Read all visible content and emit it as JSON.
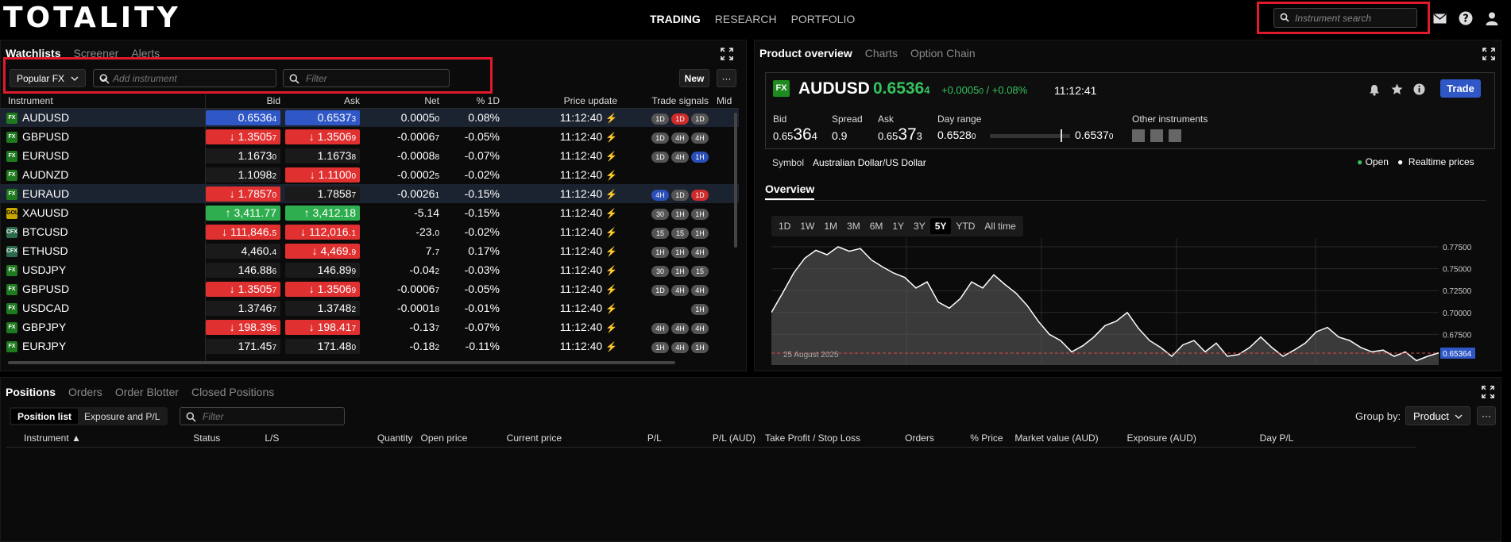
{
  "brand": {
    "logo": "TOTALITY"
  },
  "nav": {
    "items": [
      "TRADING",
      "RESEARCH",
      "PORTFOLIO"
    ]
  },
  "search": {
    "placeholder": "Instrument search"
  },
  "colors": {
    "positive": "#35c25e",
    "negative": "#e04848",
    "accent": "#2f57c6",
    "highlight": "#e01a2b"
  },
  "watchlist": {
    "tabs": [
      "Watchlists",
      "Screener",
      "Alerts"
    ],
    "selected_list": "Popular FX",
    "add_placeholder": "Add instrument",
    "filter_placeholder": "Filter",
    "new_label": "New",
    "more_label": "···",
    "columns": [
      "Instrument",
      "Bid",
      "Ask",
      "Net",
      "% 1D",
      "Price update",
      "Trade signals",
      "Mid"
    ],
    "rows": [
      {
        "icon": "FX",
        "name": "AUDUSD",
        "bid": "0.6536",
        "bid_s": "4",
        "bid_c": "blue",
        "ask": "0.6537",
        "ask_s": "3",
        "ask_c": "blue",
        "net": "0.0005",
        "net_s": "0",
        "pct": "0.08%",
        "dir": "pos",
        "time": "11:12:40",
        "signals": [
          "1D",
          "1D",
          "1D"
        ],
        "sig_colors": [
          "",
          "r",
          ""
        ]
      },
      {
        "icon": "FX",
        "name": "GBPUSD",
        "bid": "↓ 1.3505",
        "bid_s": "7",
        "bid_c": "red",
        "ask": "↓ 1.3506",
        "ask_s": "9",
        "ask_c": "red",
        "net": "-0.0006",
        "net_s": "7",
        "pct": "-0.05%",
        "dir": "neg",
        "time": "11:12:40",
        "signals": [
          "1D",
          "4H",
          "4H"
        ],
        "sig_colors": [
          "",
          "",
          ""
        ]
      },
      {
        "icon": "FX",
        "name": "EURUSD",
        "bid": "1.1673",
        "bid_s": "0",
        "bid_c": "plain",
        "ask": "1.1673",
        "ask_s": "8",
        "ask_c": "plain",
        "net": "-0.0008",
        "net_s": "8",
        "pct": "-0.07%",
        "dir": "neg",
        "time": "11:12:40",
        "signals": [
          "1D",
          "4H",
          "1H"
        ],
        "sig_colors": [
          "",
          "",
          "b"
        ]
      },
      {
        "icon": "FX",
        "name": "AUDNZD",
        "bid": "1.1098",
        "bid_s": "2",
        "bid_c": "plain",
        "ask": "↓ 1.1100",
        "ask_s": "0",
        "ask_c": "red",
        "net": "-0.0002",
        "net_s": "5",
        "pct": "-0.02%",
        "dir": "neg",
        "time": "11:12:40",
        "signals": [],
        "sig_colors": []
      },
      {
        "icon": "FX",
        "name": "EURAUD",
        "bid": "↓ 1.7857",
        "bid_s": "0",
        "bid_c": "red",
        "ask": "1.7858",
        "ask_s": "7",
        "ask_c": "plain",
        "net": "-0.0026",
        "net_s": "1",
        "pct": "-0.15%",
        "dir": "neg",
        "time": "11:12:40",
        "signals": [
          "4H",
          "1D",
          "1D"
        ],
        "sig_colors": [
          "b",
          "",
          "r"
        ]
      },
      {
        "icon": "GOLD",
        "name": "XAUUSD",
        "bid": "↑ 3,411.77",
        "bid_s": "",
        "bid_c": "green",
        "ask": "↑ 3,412.18",
        "ask_s": "",
        "ask_c": "green",
        "net": "-5.14",
        "net_s": "",
        "pct": "-0.15%",
        "dir": "neg",
        "time": "11:12:40",
        "signals": [
          "30",
          "1H",
          "1H"
        ],
        "sig_colors": [
          "",
          "",
          ""
        ]
      },
      {
        "icon": "CFX",
        "name": "BTCUSD",
        "bid": "↓ 111,846.",
        "bid_s": "5",
        "bid_c": "red",
        "ask": "↓ 112,016.",
        "ask_s": "1",
        "ask_c": "red",
        "net": "-23.",
        "net_s": "0",
        "pct": "-0.02%",
        "dir": "neg",
        "time": "11:12:40",
        "signals": [
          "15",
          "15",
          "1H"
        ],
        "sig_colors": [
          "",
          "",
          ""
        ]
      },
      {
        "icon": "CFX",
        "name": "ETHUSD",
        "bid": "4,460.",
        "bid_s": "4",
        "bid_c": "plain",
        "ask": "↓ 4,469.",
        "ask_s": "9",
        "ask_c": "red",
        "net": "7.",
        "net_s": "7",
        "pct": "0.17%",
        "dir": "pos",
        "time": "11:12:40",
        "signals": [
          "1H",
          "1H",
          "4H"
        ],
        "sig_colors": [
          "",
          "",
          ""
        ]
      },
      {
        "icon": "FX",
        "name": "USDJPY",
        "bid": "146.88",
        "bid_s": "6",
        "bid_c": "plain",
        "ask": "146.89",
        "ask_s": "9",
        "ask_c": "plain",
        "net": "-0.04",
        "net_s": "2",
        "pct": "-0.03%",
        "dir": "neg",
        "time": "11:12:40",
        "signals": [
          "30",
          "1H",
          "15"
        ],
        "sig_colors": [
          "",
          "",
          ""
        ]
      },
      {
        "icon": "FX",
        "name": "GBPUSD",
        "bid": "↓ 1.3505",
        "bid_s": "7",
        "bid_c": "red",
        "ask": "↓ 1.3506",
        "ask_s": "9",
        "ask_c": "red",
        "net": "-0.0006",
        "net_s": "7",
        "pct": "-0.05%",
        "dir": "neg",
        "time": "11:12:40",
        "signals": [
          "1D",
          "4H",
          "4H"
        ],
        "sig_colors": [
          "",
          "",
          ""
        ]
      },
      {
        "icon": "FX",
        "name": "USDCAD",
        "bid": "1.3746",
        "bid_s": "7",
        "bid_c": "plain",
        "ask": "1.3748",
        "ask_s": "2",
        "ask_c": "plain",
        "net": "-0.0001",
        "net_s": "8",
        "pct": "-0.01%",
        "dir": "neg",
        "time": "11:12:40",
        "signals": [
          "1H"
        ],
        "sig_colors": [
          ""
        ]
      },
      {
        "icon": "FX",
        "name": "GBPJPY",
        "bid": "↓ 198.39",
        "bid_s": "5",
        "bid_c": "red",
        "ask": "↓ 198.41",
        "ask_s": "7",
        "ask_c": "red",
        "net": "-0.13",
        "net_s": "7",
        "pct": "-0.07%",
        "dir": "neg",
        "time": "11:12:40",
        "signals": [
          "4H",
          "4H",
          "4H"
        ],
        "sig_colors": [
          "",
          "",
          ""
        ]
      },
      {
        "icon": "FX",
        "name": "EURJPY",
        "bid": "171.45",
        "bid_s": "7",
        "bid_c": "plain",
        "ask": "171.48",
        "ask_s": "0",
        "ask_c": "plain",
        "net": "-0.18",
        "net_s": "2",
        "pct": "-0.11%",
        "dir": "neg",
        "time": "11:12:40",
        "signals": [
          "1H",
          "4H",
          "1H"
        ],
        "sig_colors": [
          "",
          "",
          ""
        ]
      }
    ]
  },
  "product": {
    "tabs": [
      "Product overview",
      "Charts",
      "Option Chain"
    ],
    "badge": "FX",
    "symbol": "AUDUSD",
    "price": "0.6536",
    "price_s": "4",
    "change": "+0.0005",
    "change_s": "0",
    "change_pct": "/ +0.08%",
    "time": "11:12:41",
    "trade_label": "Trade",
    "bid_label": "Bid",
    "bid_a": "0.65",
    "bid_b": "36",
    "bid_c": "4",
    "spread_label": "Spread",
    "spread": "0.9",
    "ask_label": "Ask",
    "ask_a": "0.65",
    "ask_b": "37",
    "ask_c": "3",
    "range_label": "Day range",
    "range_low": "0.6528",
    "range_low_s": "0",
    "range_high": "0.6537",
    "range_high_s": "0",
    "other_label": "Other instruments",
    "symbol_label": "Symbol",
    "symbol_name": "Australian Dollar/US Dollar",
    "open_label": "Open",
    "realtime_label": "Realtime prices",
    "overview_label": "Overview",
    "ranges": [
      "1D",
      "1W",
      "1M",
      "3M",
      "6M",
      "1Y",
      "3Y",
      "5Y",
      "YTD",
      "All time"
    ],
    "active_range": "5Y",
    "chart_date": "25 August 2025"
  },
  "chart_data": {
    "type": "area",
    "ylim": [
      0.64,
      0.785
    ],
    "yticks": [
      "0.77500",
      "0.75000",
      "0.72500",
      "0.70000",
      "0.67500"
    ],
    "last_label": "0.65364",
    "values": [
      0.7,
      0.722,
      0.745,
      0.762,
      0.771,
      0.766,
      0.775,
      0.77,
      0.773,
      0.76,
      0.752,
      0.745,
      0.74,
      0.728,
      0.735,
      0.712,
      0.705,
      0.716,
      0.735,
      0.728,
      0.743,
      0.732,
      0.722,
      0.708,
      0.69,
      0.675,
      0.668,
      0.655,
      0.662,
      0.672,
      0.685,
      0.69,
      0.7,
      0.682,
      0.668,
      0.66,
      0.65,
      0.663,
      0.668,
      0.655,
      0.665,
      0.65,
      0.652,
      0.66,
      0.672,
      0.66,
      0.65,
      0.657,
      0.665,
      0.678,
      0.683,
      0.672,
      0.668,
      0.66,
      0.655,
      0.657,
      0.65,
      0.655,
      0.645,
      0.65,
      0.654
    ]
  },
  "positions": {
    "tabs": [
      "Positions",
      "Orders",
      "Order Blotter",
      "Closed Positions"
    ],
    "subtabs": [
      "Position list",
      "Exposure and P/L"
    ],
    "filter_placeholder": "Filter",
    "group_label": "Group by:",
    "group_value": "Product",
    "more_label": "···",
    "columns": [
      "Instrument ▲",
      "Status",
      "L/S",
      "Quantity",
      "Open price",
      "Current price",
      "P/L",
      "P/L (AUD)",
      "Take Profit / Stop Loss",
      "Orders",
      "% Price",
      "Market value (AUD)",
      "Exposure (AUD)",
      "Day P/L"
    ]
  }
}
